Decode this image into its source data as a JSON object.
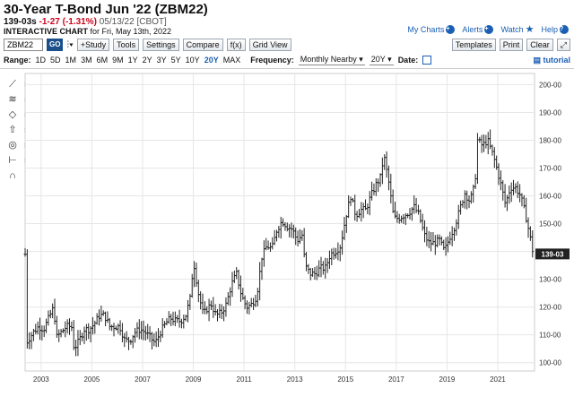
{
  "header": {
    "title": "30-Year T-Bond Jun '22 (ZBM22)",
    "price": "139-03s",
    "change": "-1-27 (-1.31%)",
    "date": "05/13/22 [CBOT]",
    "interactive_label": "INTERACTIVE CHART",
    "interactive_for": "for Fri, May 13th, 2022"
  },
  "links": {
    "my_charts": "My Charts",
    "alerts": "Alerts",
    "watch": "Watch",
    "help": "Help"
  },
  "toolbar": {
    "symbol": "ZBM22",
    "go": "GO",
    "study": "+Study",
    "tools": "Tools",
    "settings": "Settings",
    "compare": "Compare",
    "fx": "f(x)",
    "grid_view": "Grid View",
    "templates": "Templates",
    "print": "Print",
    "clear": "Clear"
  },
  "rangebar": {
    "range_label": "Range:",
    "ranges": [
      "1D",
      "5D",
      "1M",
      "3M",
      "6M",
      "9M",
      "1Y",
      "2Y",
      "3Y",
      "5Y",
      "10Y",
      "20Y",
      "MAX"
    ],
    "active_range": "20Y",
    "frequency_label": "Frequency:",
    "frequency": "Monthly Nearby",
    "period": "20Y",
    "date_label": "Date:",
    "tutorial": "tutorial"
  },
  "chart_data": {
    "type": "ohlc",
    "title": "",
    "last_label": "139-03",
    "ylim": [
      97,
      204
    ],
    "y_ticks": [
      "100-00",
      "110-00",
      "120-00",
      "130-00",
      "140-00",
      "150-00",
      "160-00",
      "170-00",
      "180-00",
      "190-00",
      "200-00"
    ],
    "y_tick_values": [
      100,
      110,
      120,
      130,
      140,
      150,
      160,
      170,
      180,
      190,
      200
    ],
    "x_ticks": [
      "2003",
      "2005",
      "2007",
      "2009",
      "2011",
      "2013",
      "2015",
      "2017",
      "2019",
      "2021"
    ],
    "x_tick_years": [
      2003,
      2005,
      2007,
      2009,
      2011,
      2013,
      2015,
      2017,
      2019,
      2021
    ],
    "x_start": 2002.37,
    "x_end": 2022.45,
    "closes": [
      [
        2002.4,
        107
      ],
      [
        2002.7,
        111
      ],
      [
        2002.9,
        113
      ],
      [
        2003.1,
        112
      ],
      [
        2003.3,
        116
      ],
      [
        2003.5,
        120
      ],
      [
        2003.6,
        109
      ],
      [
        2003.8,
        111
      ],
      [
        2004.0,
        113
      ],
      [
        2004.2,
        113
      ],
      [
        2004.3,
        105
      ],
      [
        2004.5,
        108
      ],
      [
        2004.7,
        112
      ],
      [
        2004.9,
        112
      ],
      [
        2005.1,
        114
      ],
      [
        2005.3,
        117
      ],
      [
        2005.5,
        117
      ],
      [
        2005.7,
        113
      ],
      [
        2005.9,
        113
      ],
      [
        2006.1,
        113
      ],
      [
        2006.3,
        108
      ],
      [
        2006.5,
        108
      ],
      [
        2006.7,
        111
      ],
      [
        2006.9,
        112
      ],
      [
        2007.1,
        111
      ],
      [
        2007.3,
        109
      ],
      [
        2007.5,
        107
      ],
      [
        2007.7,
        111
      ],
      [
        2007.9,
        114
      ],
      [
        2008.1,
        116
      ],
      [
        2008.3,
        115
      ],
      [
        2008.5,
        115
      ],
      [
        2008.7,
        117
      ],
      [
        2008.9,
        124
      ],
      [
        2009.0,
        137
      ],
      [
        2009.2,
        125
      ],
      [
        2009.4,
        117
      ],
      [
        2009.5,
        119
      ],
      [
        2009.7,
        121
      ],
      [
        2009.9,
        117
      ],
      [
        2010.1,
        118
      ],
      [
        2010.3,
        121
      ],
      [
        2010.5,
        128
      ],
      [
        2010.7,
        132
      ],
      [
        2010.9,
        124
      ],
      [
        2011.1,
        120
      ],
      [
        2011.3,
        121
      ],
      [
        2011.5,
        124
      ],
      [
        2011.7,
        138
      ],
      [
        2011.9,
        142
      ],
      [
        2012.1,
        141
      ],
      [
        2012.3,
        148
      ],
      [
        2012.5,
        151
      ],
      [
        2012.7,
        149
      ],
      [
        2012.9,
        148
      ],
      [
        2013.1,
        144
      ],
      [
        2013.3,
        146
      ],
      [
        2013.4,
        135
      ],
      [
        2013.6,
        132
      ],
      [
        2013.8,
        132
      ],
      [
        2014.0,
        134
      ],
      [
        2014.2,
        134
      ],
      [
        2014.4,
        139
      ],
      [
        2014.6,
        140
      ],
      [
        2014.8,
        142
      ],
      [
        2015.0,
        152
      ],
      [
        2015.2,
        160
      ],
      [
        2015.4,
        153
      ],
      [
        2015.6,
        155
      ],
      [
        2015.8,
        155
      ],
      [
        2016.0,
        160
      ],
      [
        2016.2,
        164
      ],
      [
        2016.4,
        167
      ],
      [
        2016.5,
        175
      ],
      [
        2016.7,
        165
      ],
      [
        2016.9,
        152
      ],
      [
        2017.1,
        152
      ],
      [
        2017.3,
        153
      ],
      [
        2017.5,
        154
      ],
      [
        2017.7,
        156
      ],
      [
        2017.9,
        153
      ],
      [
        2018.1,
        146
      ],
      [
        2018.3,
        143
      ],
      [
        2018.5,
        143
      ],
      [
        2018.7,
        144
      ],
      [
        2018.9,
        140
      ],
      [
        2019.1,
        145
      ],
      [
        2019.3,
        149
      ],
      [
        2019.5,
        155
      ],
      [
        2019.7,
        161
      ],
      [
        2019.9,
        158
      ],
      [
        2020.1,
        164
      ],
      [
        2020.2,
        180
      ],
      [
        2020.4,
        178
      ],
      [
        2020.6,
        180
      ],
      [
        2020.8,
        175
      ],
      [
        2020.9,
        172
      ],
      [
        2021.1,
        165
      ],
      [
        2021.3,
        157
      ],
      [
        2021.5,
        163
      ],
      [
        2021.7,
        163
      ],
      [
        2021.9,
        160
      ],
      [
        2022.1,
        153
      ],
      [
        2022.3,
        144
      ],
      [
        2022.4,
        139
      ]
    ]
  }
}
